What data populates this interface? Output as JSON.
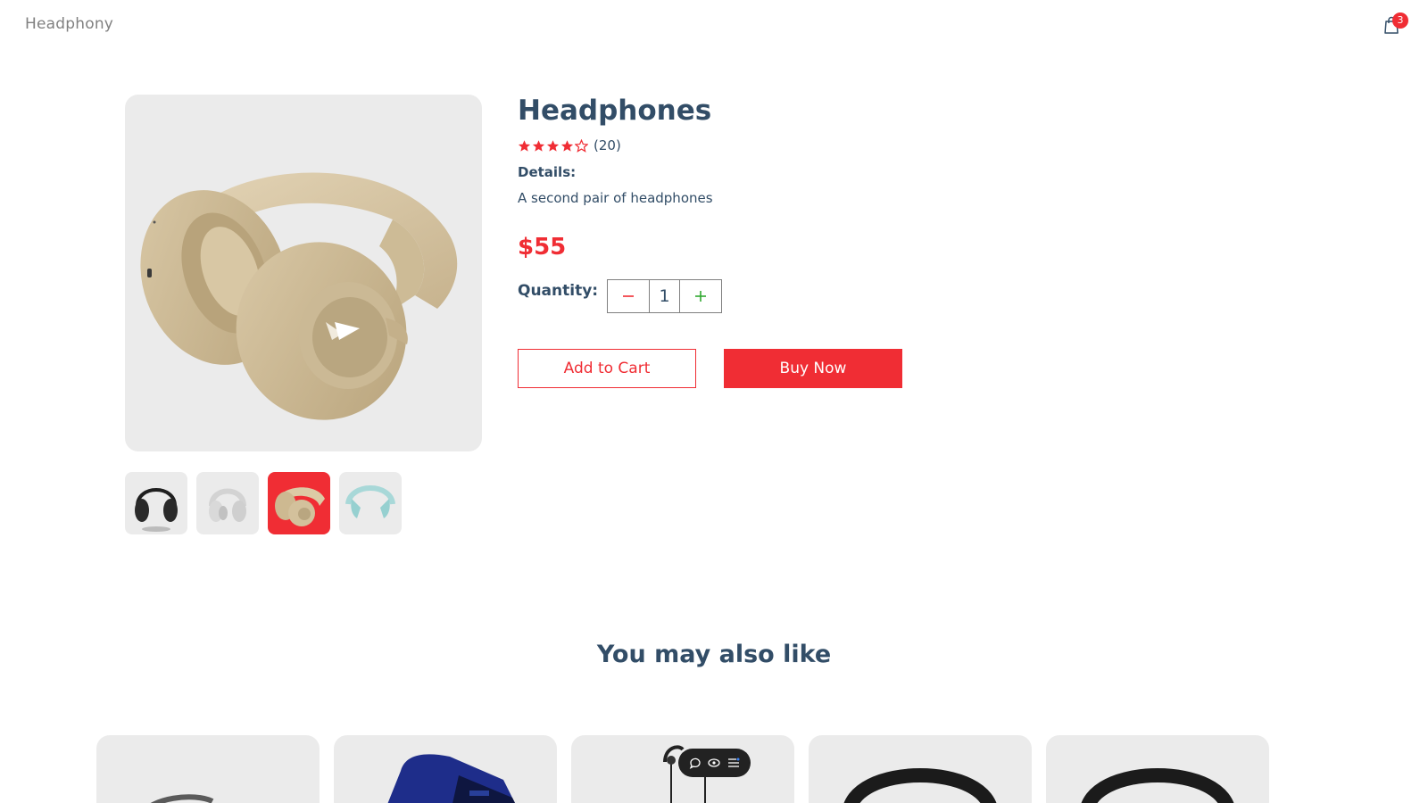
{
  "navbar": {
    "logo": "Headphony",
    "cart_icon": "shopping-bag-icon",
    "cart_count": "3"
  },
  "product": {
    "title": "Headphones",
    "rating": 4,
    "rating_max": 5,
    "review_count": "(20)",
    "details_label": "Details:",
    "details_text": "A second pair of headphones",
    "price": "$55",
    "quantity_label": "Quantity:",
    "quantity_value": "1",
    "minus_icon": "minus-icon",
    "plus_icon": "plus-icon",
    "add_to_cart_label": "Add to Cart",
    "buy_now_label": "Buy Now",
    "selected_thumbnail": 3,
    "thumbnails": [
      "black-headphones",
      "white-headphones",
      "beige-headphones",
      "light-blue-headphones"
    ]
  },
  "may_also_like": {
    "title": "You may also like",
    "items": [
      "silver-headphones",
      "blue-smartwatch",
      "black-earphones",
      "black-headphones",
      "black-headphones"
    ]
  },
  "toolbar_overlay": {
    "icons": [
      "comment-icon",
      "eye-icon",
      "list-icon"
    ]
  },
  "colors": {
    "accent": "#f02d34",
    "heading": "#324d67",
    "plus": "#31a831",
    "image_bg": "#ebebeb"
  }
}
